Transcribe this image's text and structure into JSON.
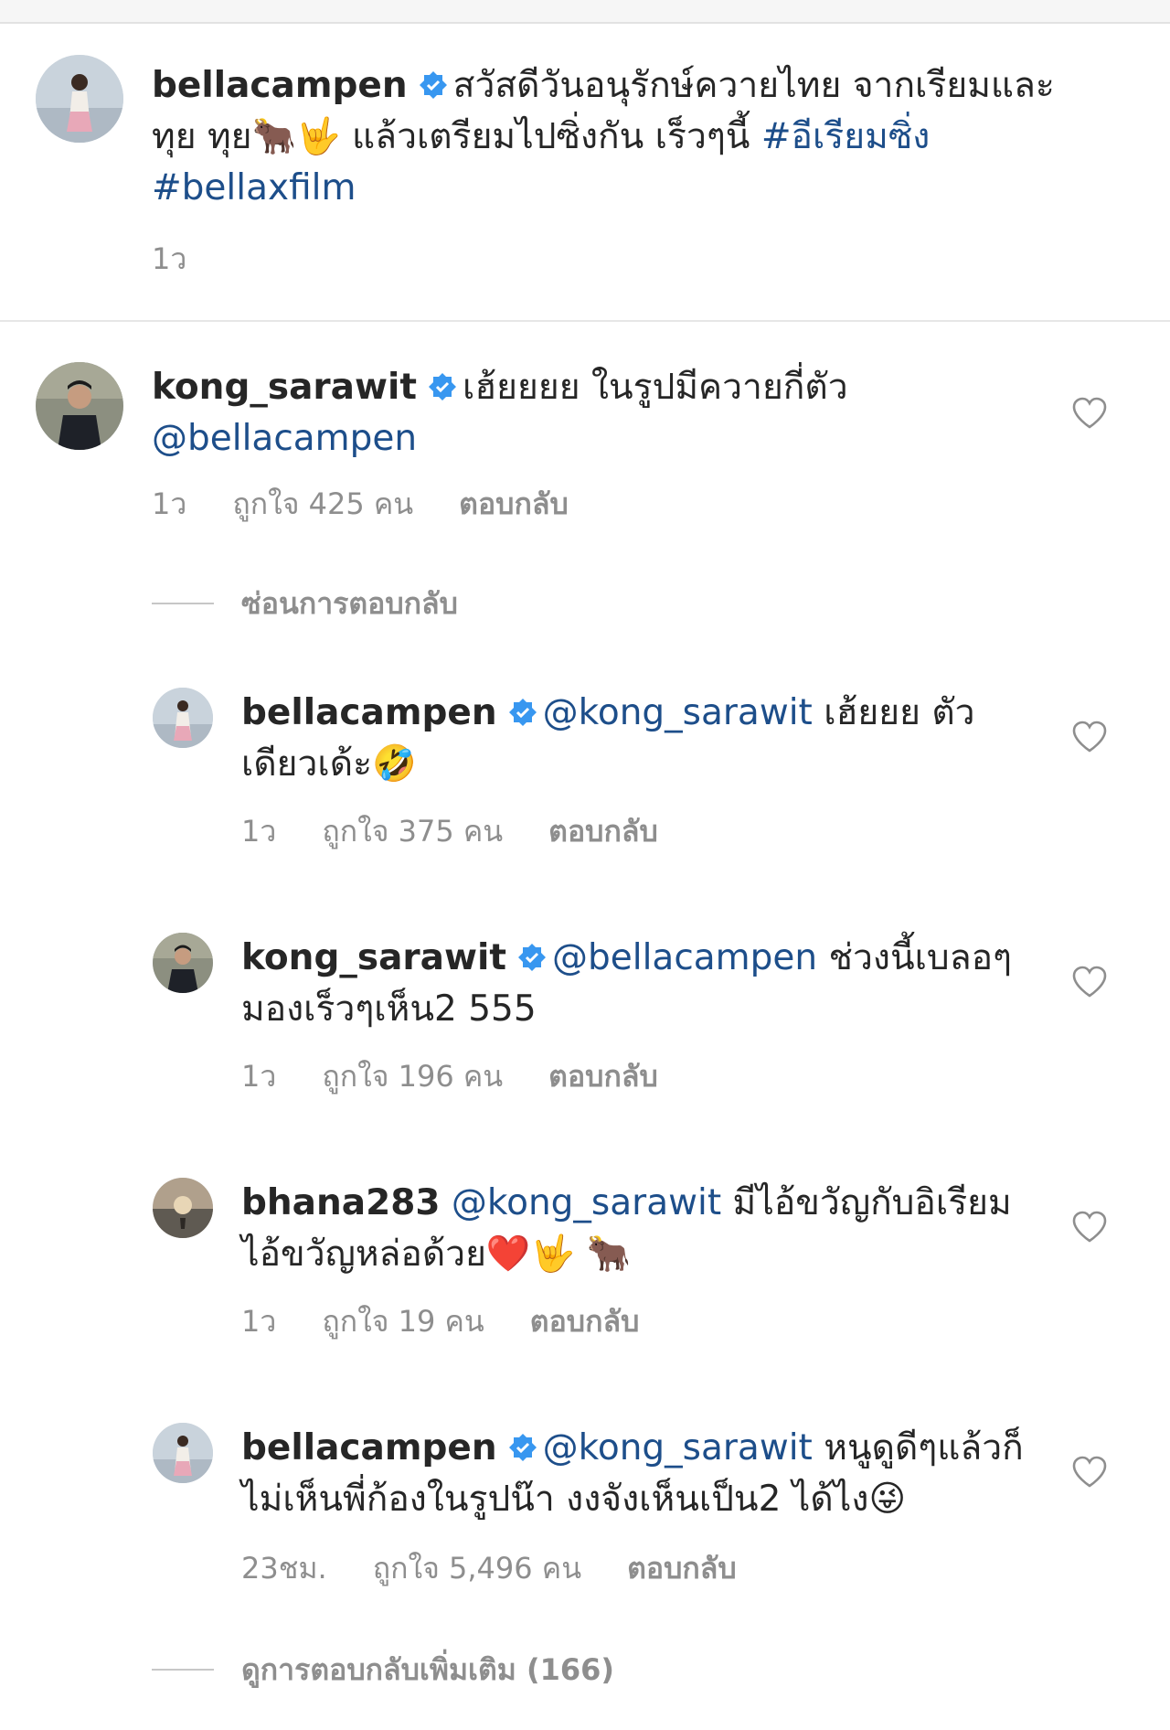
{
  "caption": {
    "username": "bellacampen",
    "text": "สวัสดีวันอนุรักษ์ควายไทย จากเรียมและทุย ทุย🐂🤟 แล้วเตรียมไปซิ่งกัน เร็วๆนี้",
    "hashtag1": "#อีเรียมซิ่ง",
    "hashtag2": "#bellaxfilm",
    "time": "1ว"
  },
  "comments": [
    {
      "username": "kong_sarawit",
      "text": "เฮ้ยยยย ในรูปมีควายกี่ตัว",
      "mention": "@bellacampen",
      "time": "1ว",
      "likes": "ถูกใจ 425 คน",
      "reply_label": "ตอบกลับ"
    }
  ],
  "hide_replies_label": "ซ่อนการตอบกลับ",
  "replies": [
    {
      "username": "bellacampen",
      "mention": "@kong_sarawit",
      "text": "เฮ้ยยย ตัวเดียวเด้ะ🤣",
      "time": "1ว",
      "likes": "ถูกใจ 375 คน",
      "reply_label": "ตอบกลับ"
    },
    {
      "username": "kong_sarawit",
      "mention": "@bellacampen",
      "text": "ช่วงนี้เบลอๆ มองเร็วๆเห็น2 555",
      "time": "1ว",
      "likes": "ถูกใจ 196 คน",
      "reply_label": "ตอบกลับ"
    },
    {
      "username": "bhana283",
      "mention": "@kong_sarawit",
      "text": "มีไอ้ขวัญกับอิเรียม ไอ้ขวัญหล่อด้วย❤️🤟 🐂",
      "time": "1ว",
      "likes": "ถูกใจ 19 คน",
      "reply_label": "ตอบกลับ"
    },
    {
      "username": "bellacampen",
      "mention": "@kong_sarawit",
      "text": "หนูดูดีๆแล้วก็ไม่เห็นพี่ก้องในรูปน๊า งงจังเห็นเป็น2 ได้ไง😜",
      "time": "23ชม.",
      "likes": "ถูกใจ 5,496 คน",
      "reply_label": "ตอบกลับ"
    }
  ],
  "more_replies_label": "ดูการตอบกลับเพิ่มเติม (166)",
  "colors": {
    "verified": "#3897f0",
    "link": "#1d4e8a",
    "meta": "#8e8e8e"
  },
  "icons": [
    "verified-badge-icon",
    "heart-icon"
  ]
}
